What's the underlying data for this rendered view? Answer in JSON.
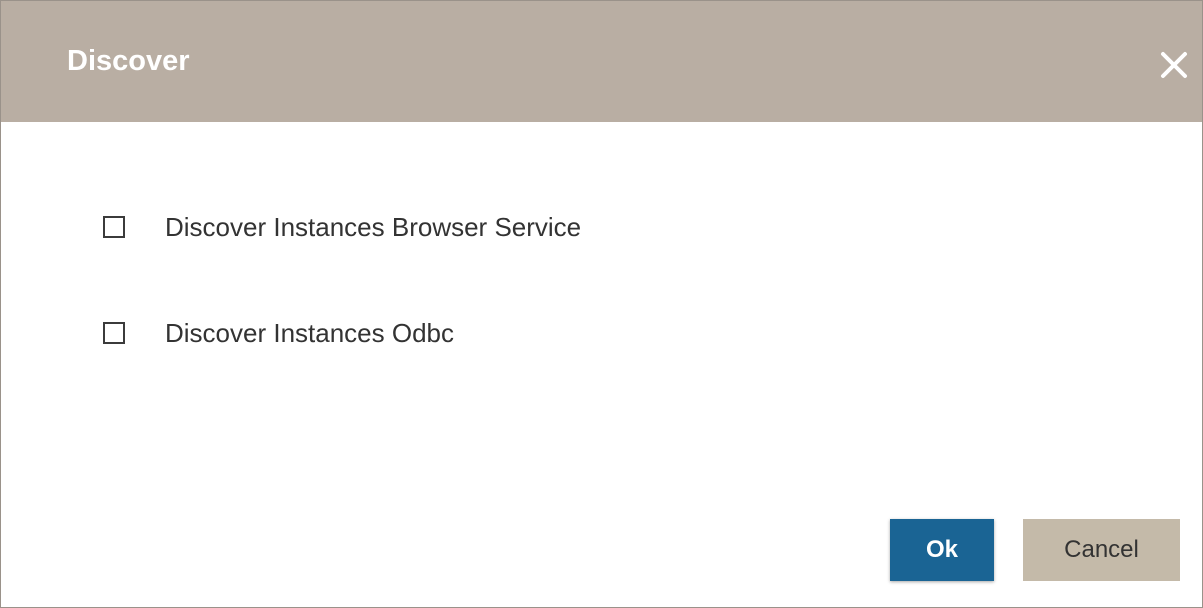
{
  "dialog": {
    "title": "Discover",
    "close_icon": "close-icon",
    "options": [
      {
        "label": "Discover Instances Browser Service",
        "checked": false
      },
      {
        "label": "Discover Instances Odbc",
        "checked": false
      }
    ],
    "buttons": {
      "ok_label": "Ok",
      "cancel_label": "Cancel"
    }
  },
  "colors": {
    "titlebar": "#b9aea3",
    "ok_button": "#1a6494",
    "cancel_button": "#c4baa9"
  }
}
